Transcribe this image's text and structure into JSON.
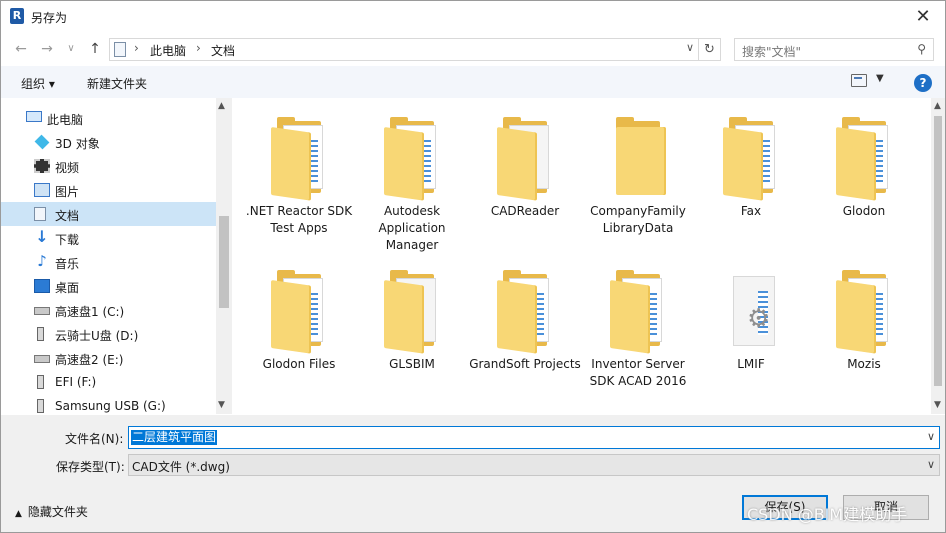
{
  "window": {
    "title": "另存为",
    "app_icon": "R",
    "close": "✕"
  },
  "nav": {
    "back": "←",
    "forward": "→",
    "recent": "∨",
    "up": "↑"
  },
  "address": {
    "crumbs": [
      "此电脑",
      "文档"
    ],
    "sep": "›"
  },
  "search": {
    "placeholder": "搜索\"文档\""
  },
  "toolbar": {
    "organize": "组织 ▾",
    "new_folder": "新建文件夹",
    "help": "?"
  },
  "sidebar": {
    "items": [
      {
        "label": "此电脑",
        "icon": "pc-icon"
      },
      {
        "label": "3D 对象",
        "icon": "3d-objects-icon"
      },
      {
        "label": "视频",
        "icon": "video-icon"
      },
      {
        "label": "图片",
        "icon": "pictures-icon"
      },
      {
        "label": "文档",
        "icon": "documents-icon",
        "selected": true
      },
      {
        "label": "下载",
        "icon": "download-icon"
      },
      {
        "label": "音乐",
        "icon": "music-icon"
      },
      {
        "label": "桌面",
        "icon": "desktop-icon"
      },
      {
        "label": "高速盘1 (C:)",
        "icon": "drive-icon"
      },
      {
        "label": "云骑士U盘 (D:)",
        "icon": "usb-drive-icon"
      },
      {
        "label": "高速盘2 (E:)",
        "icon": "drive-icon"
      },
      {
        "label": "EFI (F:)",
        "icon": "usb-drive-icon"
      },
      {
        "label": "Samsung USB (G:)",
        "icon": "usb-drive-icon"
      }
    ]
  },
  "files": [
    {
      "name": ".NET Reactor SDK Test Apps",
      "kind": "folder"
    },
    {
      "name": "Autodesk Application Manager",
      "kind": "folder"
    },
    {
      "name": "CADReader",
      "kind": "blank"
    },
    {
      "name": "CompanyFamily LibraryData",
      "kind": "plain"
    },
    {
      "name": "Fax",
      "kind": "folder"
    },
    {
      "name": "Glodon",
      "kind": "folder"
    },
    {
      "name": "Glodon Files",
      "kind": "folder"
    },
    {
      "name": "GLSBIM",
      "kind": "blank"
    },
    {
      "name": "GrandSoft Projects",
      "kind": "folder"
    },
    {
      "name": "Inventor Server SDK ACAD 2016",
      "kind": "folder"
    },
    {
      "name": "LMIF",
      "kind": "file"
    },
    {
      "name": "Mozis",
      "kind": "folder"
    }
  ],
  "form": {
    "filename_label": "文件名(N):",
    "filename_value": "二层建筑平面图",
    "filetype_label": "保存类型(T):",
    "filetype_value": "CAD文件  (*.dwg)"
  },
  "footer": {
    "hide_folders": "隐藏文件夹",
    "save": "保存(S)",
    "cancel": "取消"
  },
  "watermark": "CSDN @BIM建模助手"
}
